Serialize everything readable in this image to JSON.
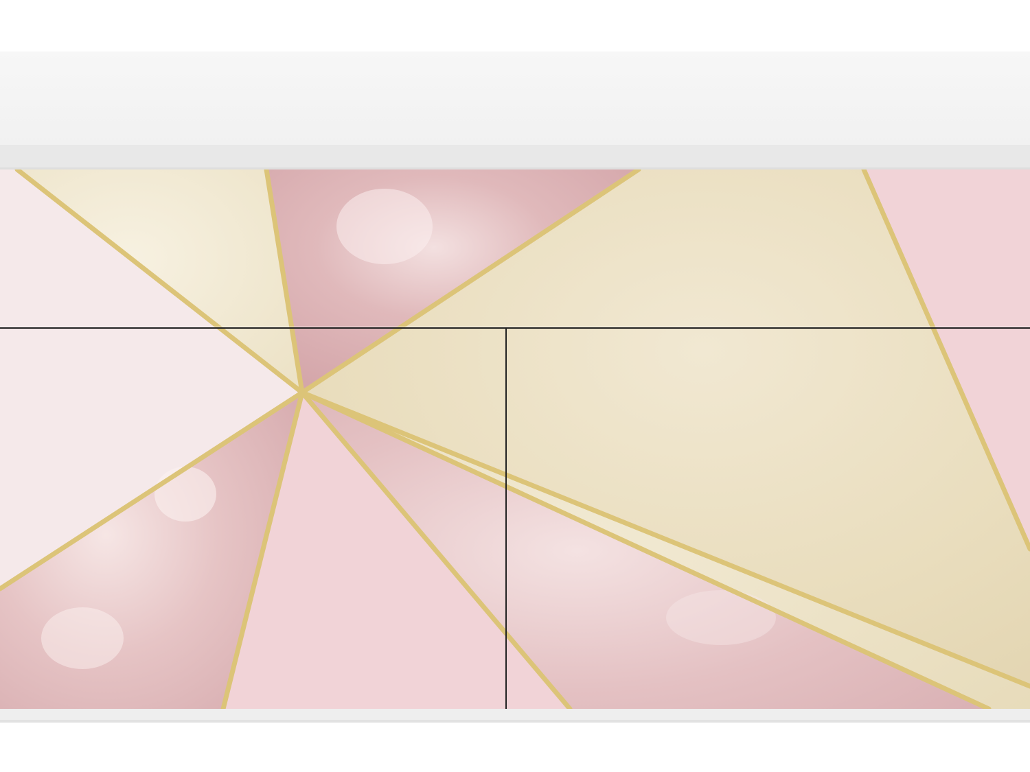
{
  "scene": {
    "subject": "sideboard-front-with-geometric-decal",
    "colors": {
      "background": "#ffffff",
      "cabinet_top": "#f4f4f4",
      "cabinet_shadow": "#e7e7e7",
      "cabinet_frame": "#eeeeee",
      "blush_light": "#f5e9ea",
      "blush": "#f1d3d7",
      "rose_foil": "#dcb2b5",
      "rose_foil_light": "#edd4d6",
      "cream": "#f2ead7",
      "champagne": "#ece2c4",
      "gold_line": "#dcc478",
      "seam": "#222222"
    }
  }
}
